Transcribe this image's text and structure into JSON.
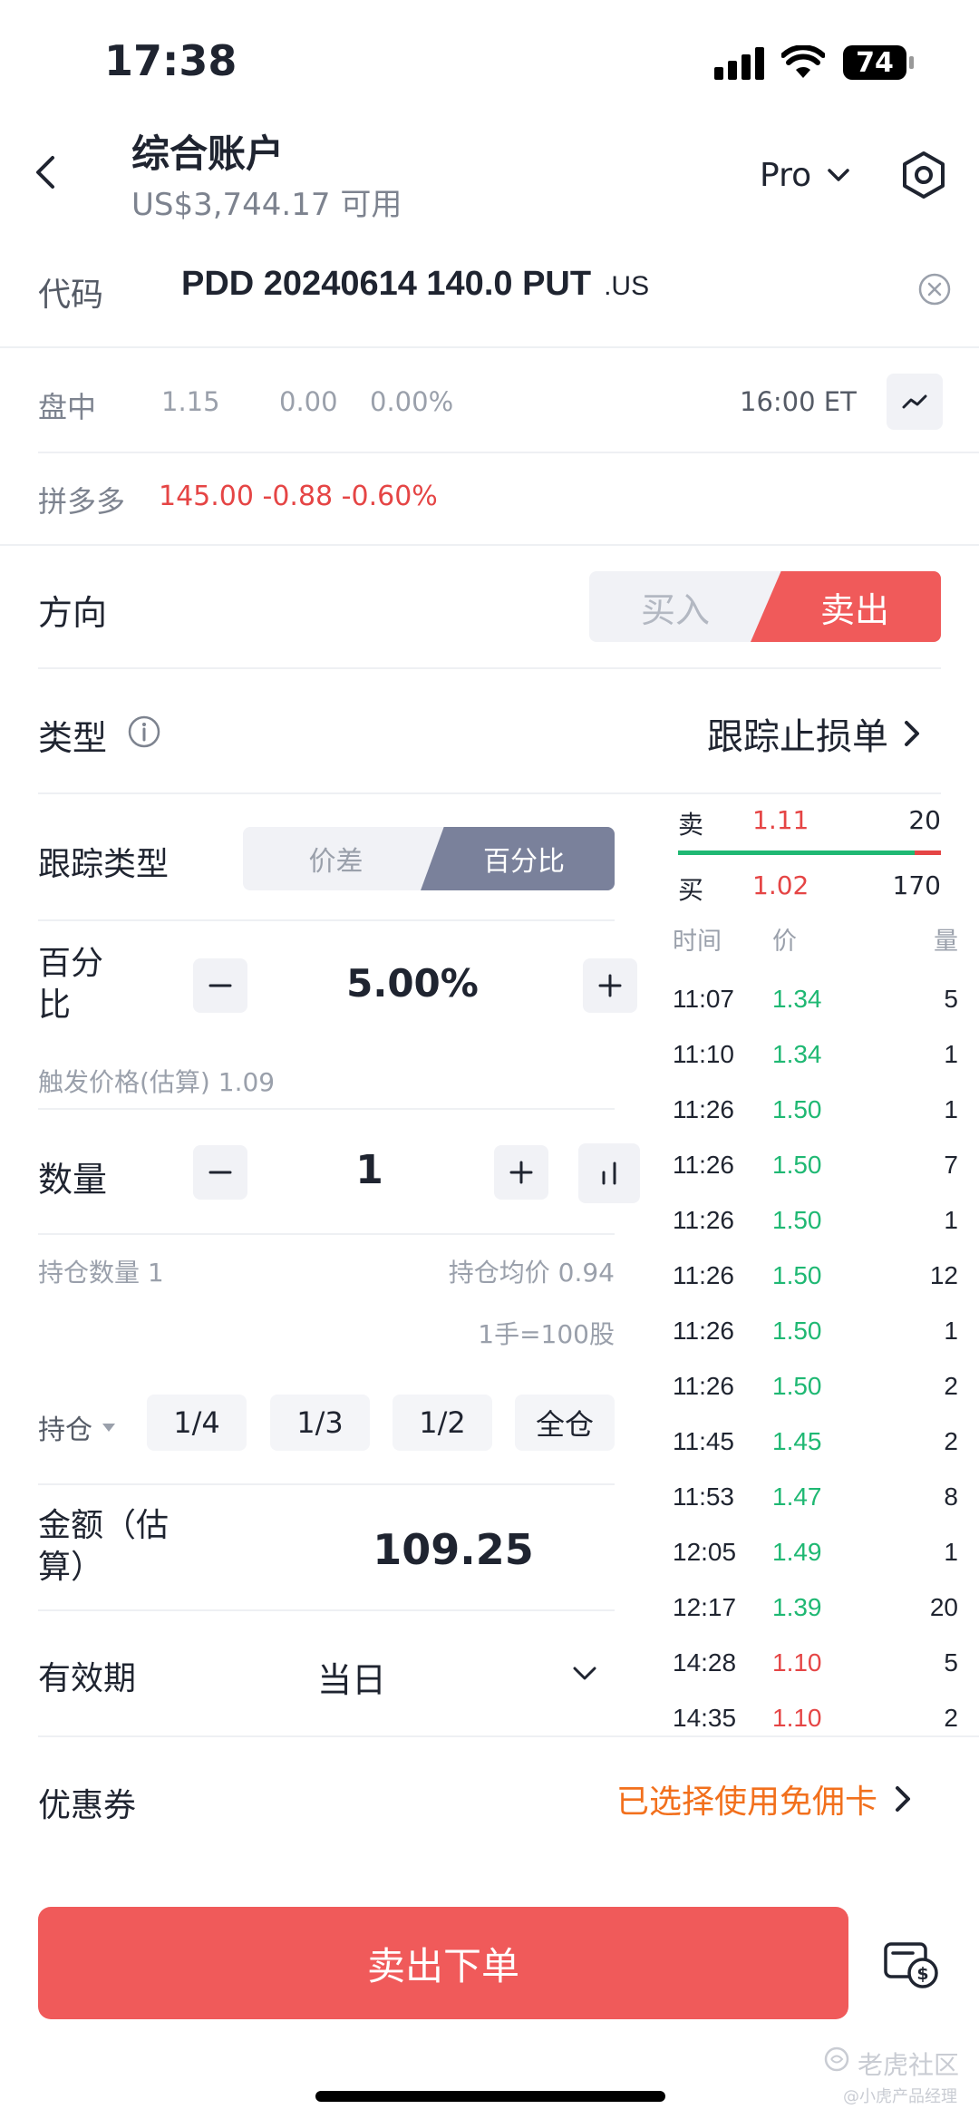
{
  "status_bar": {
    "time": "17:38",
    "battery": "74"
  },
  "header": {
    "title": "综合账户",
    "subtitle": "US$3,744.17 可用",
    "mode": "Pro"
  },
  "symbol": {
    "label": "代码",
    "code": "PDD 20240614 140.0 PUT",
    "market": ".US"
  },
  "quote": {
    "session": "盘中",
    "price": "1.15",
    "change": "0.00",
    "change_pct": "0.00%",
    "time": "16:00 ET"
  },
  "underlying": {
    "name": "拼多多",
    "price_change": "145.00 -0.88 -0.60%"
  },
  "direction": {
    "label": "方向",
    "buy": "买入",
    "sell": "卖出",
    "selected": "sell"
  },
  "order_type": {
    "label": "类型",
    "value": "跟踪止损单"
  },
  "trail": {
    "type_label": "跟踪类型",
    "opt_spread": "价差",
    "opt_percent": "百分比",
    "selected": "percent",
    "percent_label_1": "百分",
    "percent_label_2": "比",
    "percent_value": "5.00%",
    "trigger_label": "触发价格(估算) 1.09"
  },
  "quantity": {
    "label": "数量",
    "value": "1",
    "holding": "持仓数量 1",
    "avg_cost": "持仓均价 0.94",
    "lot": "1手=100股"
  },
  "position": {
    "label": "持仓",
    "q1": "1/4",
    "q2": "1/3",
    "q3": "1/2",
    "all": "全仓"
  },
  "amount": {
    "label_1": "金额（估",
    "label_2": "算）",
    "value": "109.25"
  },
  "validity": {
    "label": "有效期",
    "value": "当日"
  },
  "coupon": {
    "label": "优惠券",
    "value": "已选择使用免佣卡"
  },
  "submit": {
    "label": "卖出下单"
  },
  "orderbook": {
    "ask_label": "卖",
    "ask_price": "1.11",
    "ask_qty": "20",
    "bid_label": "买",
    "bid_price": "1.02",
    "bid_qty": "170",
    "ask_ratio": 0.1
  },
  "trades_header": {
    "time": "时间",
    "price": "价",
    "qty": "量"
  },
  "trades": [
    {
      "time": "11:07",
      "price": "1.34",
      "qty": "5",
      "color": "#1fb873"
    },
    {
      "time": "11:10",
      "price": "1.34",
      "qty": "1",
      "color": "#1fb873"
    },
    {
      "time": "11:26",
      "price": "1.50",
      "qty": "1",
      "color": "#1fb873"
    },
    {
      "time": "11:26",
      "price": "1.50",
      "qty": "7",
      "color": "#1fb873"
    },
    {
      "time": "11:26",
      "price": "1.50",
      "qty": "1",
      "color": "#1fb873"
    },
    {
      "time": "11:26",
      "price": "1.50",
      "qty": "12",
      "color": "#1fb873"
    },
    {
      "time": "11:26",
      "price": "1.50",
      "qty": "1",
      "color": "#1fb873"
    },
    {
      "time": "11:26",
      "price": "1.50",
      "qty": "2",
      "color": "#1fb873"
    },
    {
      "time": "11:45",
      "price": "1.45",
      "qty": "2",
      "color": "#1fb873"
    },
    {
      "time": "11:53",
      "price": "1.47",
      "qty": "8",
      "color": "#1fb873"
    },
    {
      "time": "12:05",
      "price": "1.49",
      "qty": "1",
      "color": "#1fb873"
    },
    {
      "time": "12:17",
      "price": "1.39",
      "qty": "20",
      "color": "#1fb873"
    },
    {
      "time": "14:28",
      "price": "1.10",
      "qty": "5",
      "color": "#e54545"
    },
    {
      "time": "14:35",
      "price": "1.10",
      "qty": "2",
      "color": "#e54545"
    }
  ],
  "watermark": {
    "brand": "老虎社区",
    "author": "@小虎产品经理"
  },
  "colors": {
    "accent_red": "#f05a5a",
    "gain": "#1fb873",
    "loss": "#e54545",
    "coupon_orange": "#f2701d",
    "seg_selected": "#7a819b"
  }
}
